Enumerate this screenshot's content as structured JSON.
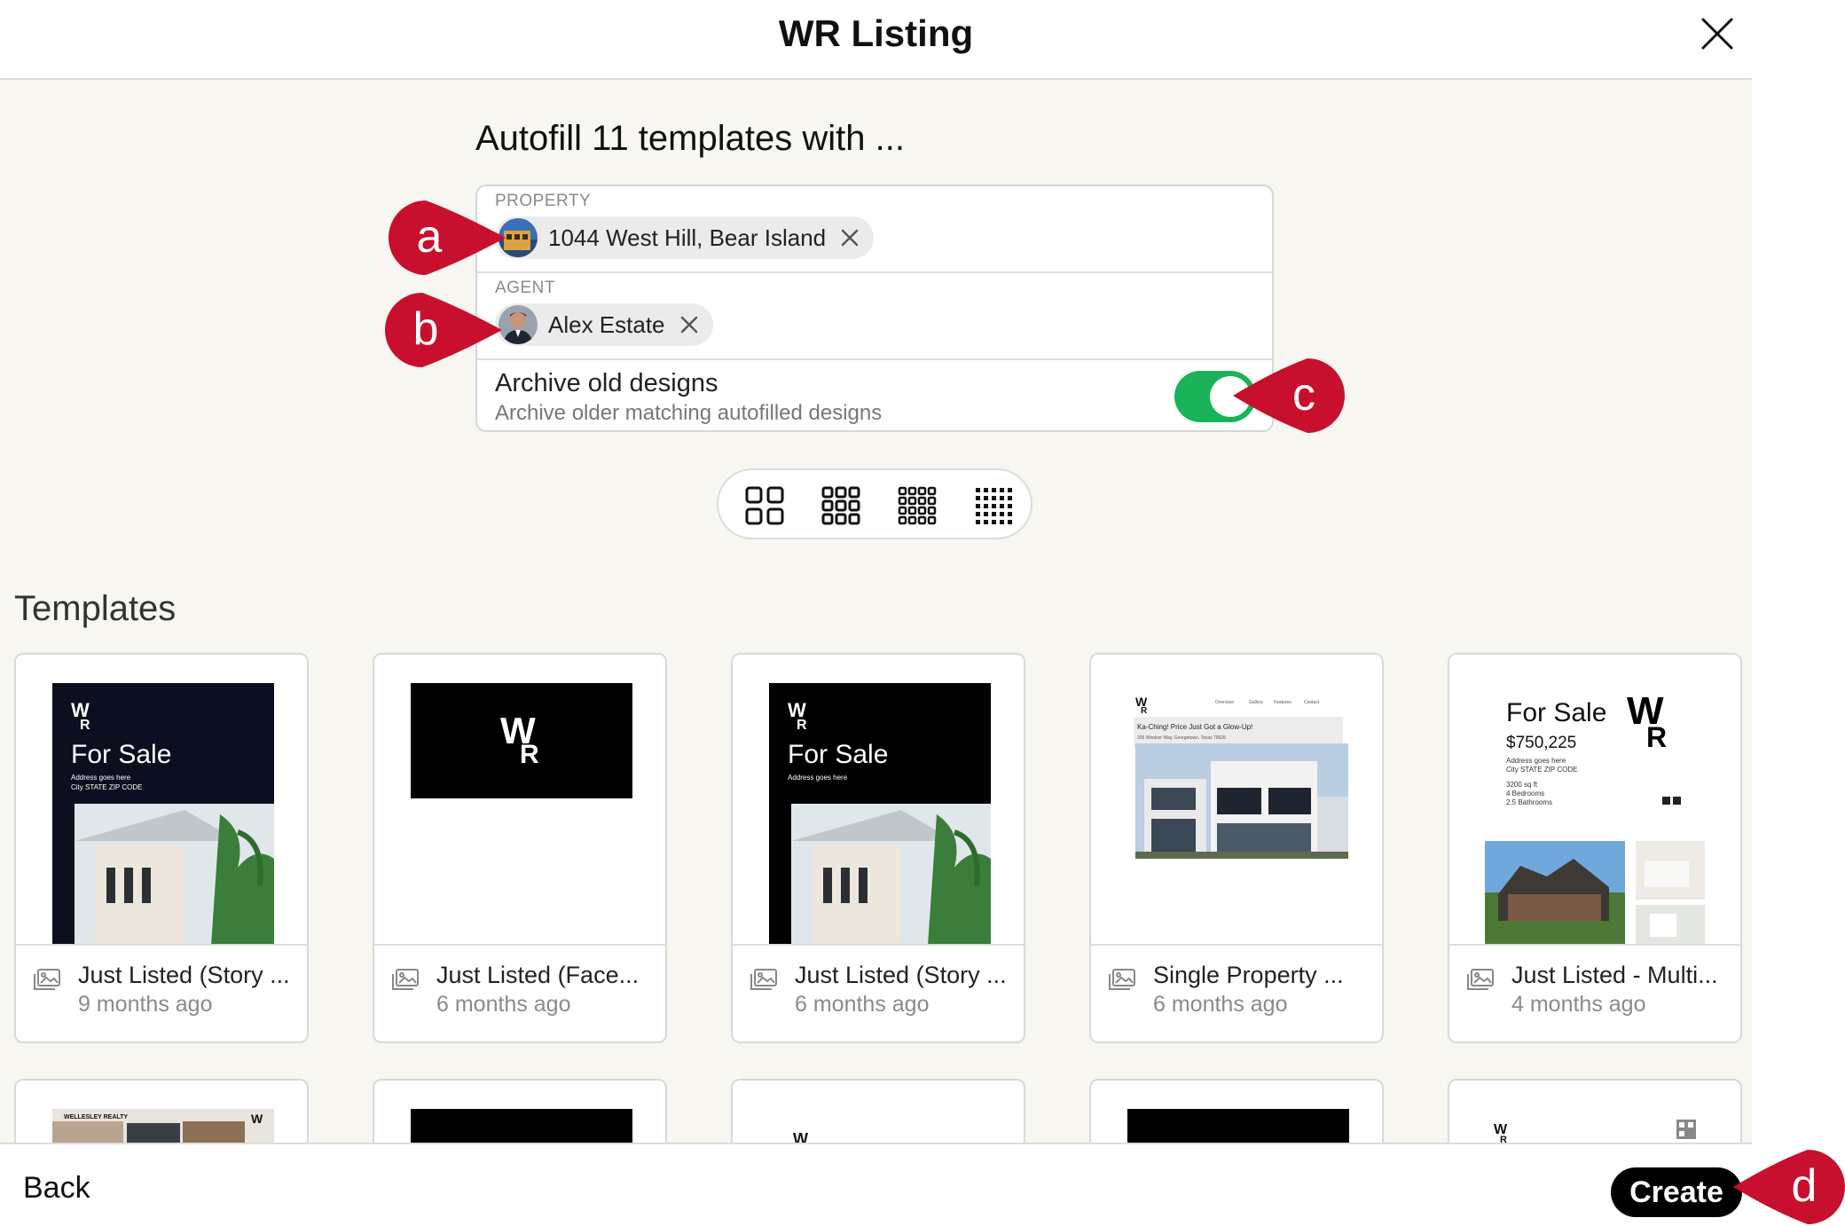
{
  "header": {
    "title": "WR Listing"
  },
  "autofill": {
    "title": "Autofill 11 templates with ..."
  },
  "property": {
    "label": "PROPERTY",
    "value": "1044 West Hill, Bear Island"
  },
  "agent": {
    "label": "AGENT",
    "value": "Alex Estate"
  },
  "archive": {
    "title": "Archive old designs",
    "subtitle": "Archive older matching autofilled designs",
    "enabled": true
  },
  "templates": {
    "heading": "Templates",
    "items": [
      {
        "title": "Just Listed (Story ...",
        "time": "9 months ago",
        "thumb": {
          "heading": "For Sale",
          "line1": "Address goes here",
          "line2": "City STATE ZIP CODE"
        }
      },
      {
        "title": "Just Listed (Face...",
        "time": "6 months ago"
      },
      {
        "title": "Just Listed (Story ...",
        "time": "6 months ago",
        "thumb": {
          "heading": "For Sale",
          "line1": "Address goes here"
        }
      },
      {
        "title": "Single Property ...",
        "time": "6 months ago",
        "thumb": {
          "nav": [
            "Overview",
            "Gallery",
            "Features",
            "Contact"
          ],
          "headline": "Ka-Ching! Price Just Got a Glow-Up!",
          "address": "205 Windsor Way, Georgetown, Texas 78626"
        }
      },
      {
        "title": "Just Listed - Multi...",
        "time": "4 months ago",
        "thumb": {
          "heading": "For Sale",
          "price": "$750,225",
          "line1": "Address goes here",
          "line2": "City STATE ZIP CODE",
          "sqft": "3200 sq ft",
          "beds": "4 Bedrooms",
          "baths": "2.5 Bathrooms"
        }
      }
    ],
    "row2_thumb_label": "WELLESLEY REALTY"
  },
  "footer": {
    "back_label": "Back",
    "create_label": "Create"
  },
  "callouts": [
    "a",
    "b",
    "c",
    "d"
  ],
  "colors": {
    "accent_green": "#1bb35a",
    "callout_red": "#c8102e",
    "dark_navy": "#0b0f1f"
  }
}
